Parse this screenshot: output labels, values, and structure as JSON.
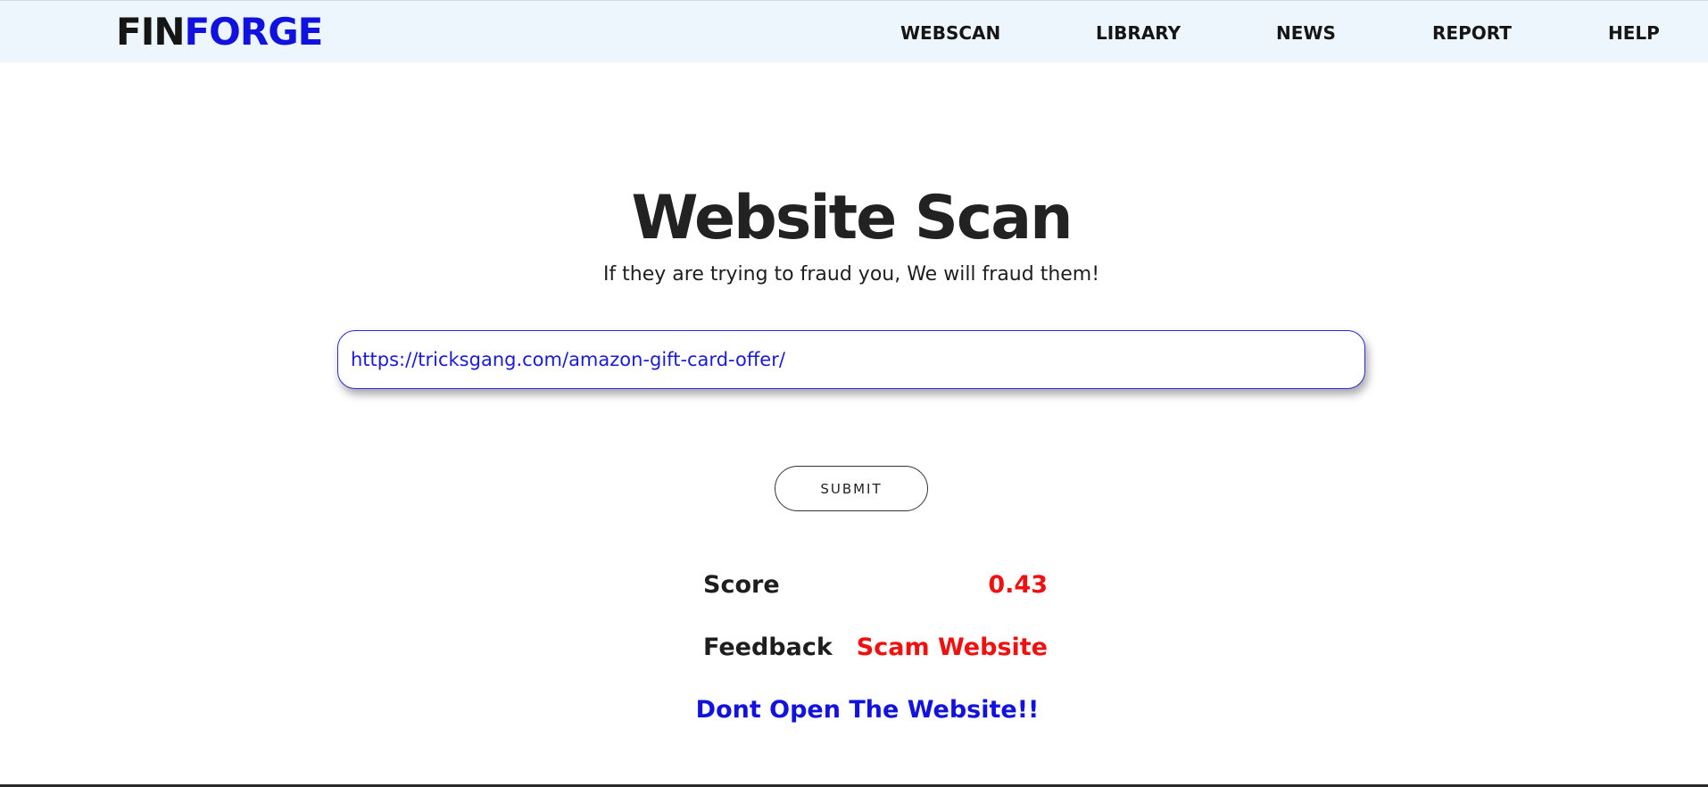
{
  "header": {
    "logo": {
      "part1": "FIN",
      "part2": "FORGE"
    },
    "nav": [
      {
        "label": "WEBSCAN"
      },
      {
        "label": "LIBRARY"
      },
      {
        "label": "NEWS"
      },
      {
        "label": "REPORT"
      },
      {
        "label": "HELP"
      }
    ]
  },
  "main": {
    "title": "Website Scan",
    "subtitle": "If they are trying to fraud you, We will fraud them!",
    "url_input": {
      "value": "https://tricksgang.com/amazon-gift-card-offer/"
    },
    "submit_label": "SUBMIT",
    "results": {
      "score_label": "Score",
      "score_value": "0.43",
      "feedback_label": "Feedback",
      "feedback_value": "Scam Website",
      "warning": "Dont Open The Website!!"
    }
  },
  "colors": {
    "brand_accent": "#1111e0",
    "danger": "#f01010",
    "warning_text": "#1111e0",
    "nav_background": "#eef6fd"
  }
}
